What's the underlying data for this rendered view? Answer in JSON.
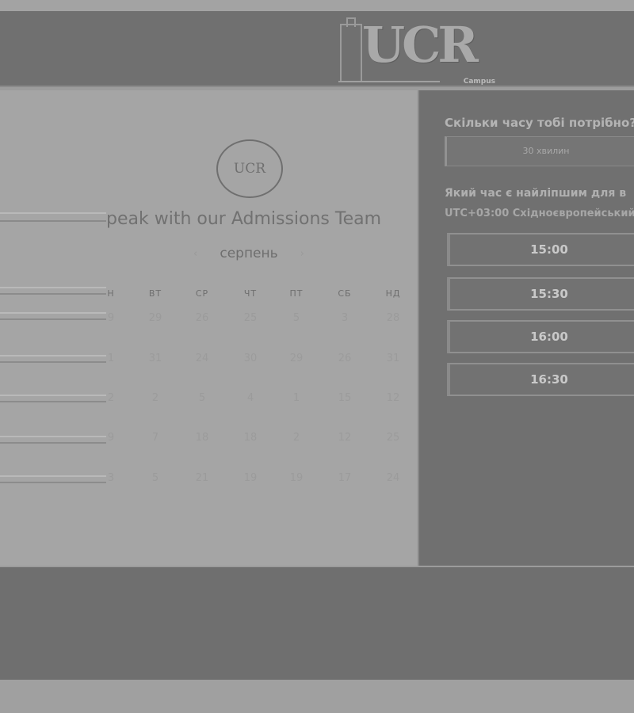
{
  "header": {
    "logo_text": "UCR",
    "logo_sub": "Campus"
  },
  "booking": {
    "circle_logo_text": "UCR",
    "heading": "peak with our Admissions Team",
    "month": "серпень",
    "prev_icon": "chevron-left-icon",
    "next_icon": "chevron-right-icon",
    "weekdays": [
      "Н",
      "ВТ",
      "СР",
      "ЧТ",
      "ПТ",
      "СБ",
      "НД"
    ],
    "weeks": [
      [
        "9",
        "29",
        "26",
        "25",
        "5",
        "3",
        "28"
      ],
      [
        "1",
        "31",
        "24",
        "30",
        "29",
        "26",
        "31"
      ],
      [
        "2",
        "2",
        "5",
        "4",
        "1",
        "15",
        "12"
      ],
      [
        "9",
        "7",
        "18",
        "18",
        "2",
        "12",
        "25"
      ],
      [
        "3",
        "5",
        "21",
        "19",
        "19",
        "17",
        "24"
      ]
    ]
  },
  "sidebar": {
    "duration_question": "Скільки часу тобі потрібно?",
    "duration_value": "30 хвилин",
    "time_question": "Який час є найліпшим для в",
    "timezone": "UTC+03:00 Східноєвропейський",
    "slots": [
      "15:00",
      "15:30",
      "16:00",
      "16:30"
    ]
  }
}
